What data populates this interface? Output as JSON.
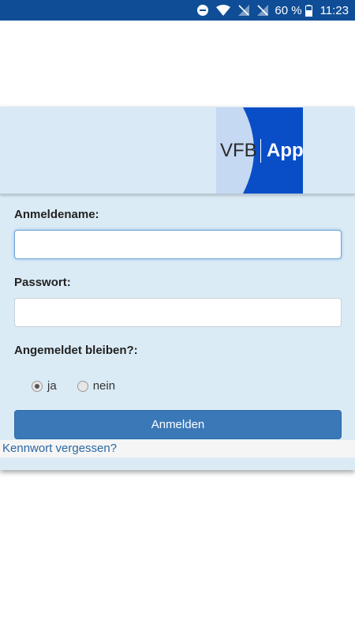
{
  "status_bar": {
    "battery": "60 %",
    "time": "11:23",
    "icons": [
      "do-not-disturb-icon",
      "wifi-icon",
      "no-signal-icon",
      "no-signal-icon",
      "battery-icon"
    ]
  },
  "header": {
    "logo_left": "VFB",
    "logo_right": "App"
  },
  "form": {
    "username_label": "Anmeldename:",
    "username_value": "",
    "password_label": "Passwort:",
    "password_value": "",
    "remember_label": "Angemeldet bleiben?:",
    "options": [
      {
        "label": "ja",
        "checked": true
      },
      {
        "label": "nein",
        "checked": false
      }
    ],
    "submit_label": "Anmelden",
    "forgot_link": "Kennwort vergessen?"
  },
  "colors": {
    "status_bar": "#0f4e97",
    "card_bg": "#dbebf5",
    "logo_blue": "#0a4ec7",
    "button": "#3a78b8",
    "link": "#2a67a3"
  }
}
